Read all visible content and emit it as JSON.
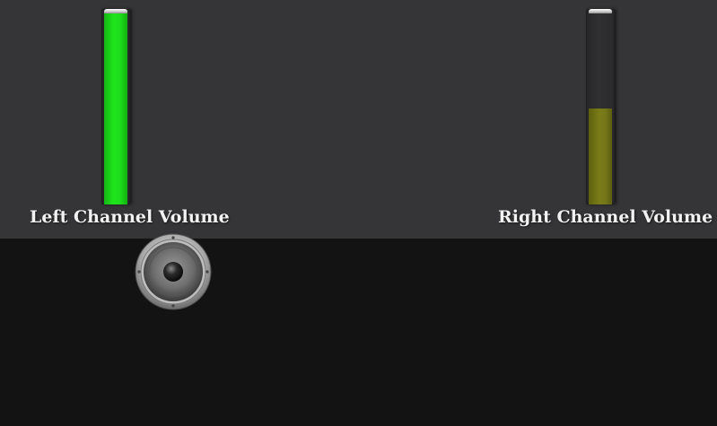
{
  "channels": {
    "left": {
      "label": "Left Channel Volume",
      "level": 1.0,
      "fill_color": "#1fe51c"
    },
    "right": {
      "label": "Right Channel Volume",
      "level": 0.5,
      "fill_color": "#7a7c17"
    }
  },
  "speaker": {
    "icon": "speaker-icon"
  },
  "colors": {
    "top_panel": "#353537",
    "background": "#131313",
    "label_text": "#f2f2f2"
  }
}
